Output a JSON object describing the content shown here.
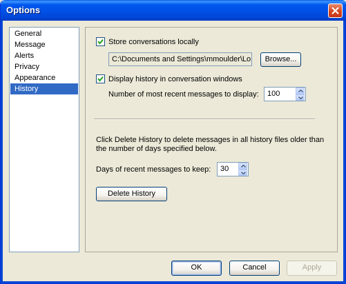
{
  "window": {
    "title": "Options"
  },
  "sidebar": {
    "items": [
      {
        "label": "General"
      },
      {
        "label": "Message"
      },
      {
        "label": "Alerts"
      },
      {
        "label": "Privacy"
      },
      {
        "label": "Appearance"
      },
      {
        "label": "History",
        "selected": true
      }
    ]
  },
  "history": {
    "store_locally": {
      "label": "Store conversations locally",
      "checked": true
    },
    "path": {
      "value": "C:\\Documents and Settings\\mmoulder\\Lo"
    },
    "browse_label": "Browse...",
    "display_history": {
      "label": "Display history in conversation windows",
      "checked": true
    },
    "recent_messages": {
      "label": "Number of most recent messages to display:",
      "value": "100"
    },
    "delete_description_line1": "Click Delete History to delete messages in all history files older than",
    "delete_description_line2": "the number of days specified below.",
    "days_to_keep": {
      "label": "Days of recent messages to keep:",
      "value": "30"
    },
    "delete_button": "Delete History"
  },
  "footer": {
    "ok": "OK",
    "cancel": "Cancel",
    "apply": "Apply"
  },
  "colors": {
    "titlebar": "#0054e3",
    "selection": "#316ac5",
    "close_button": "#d6451e"
  }
}
